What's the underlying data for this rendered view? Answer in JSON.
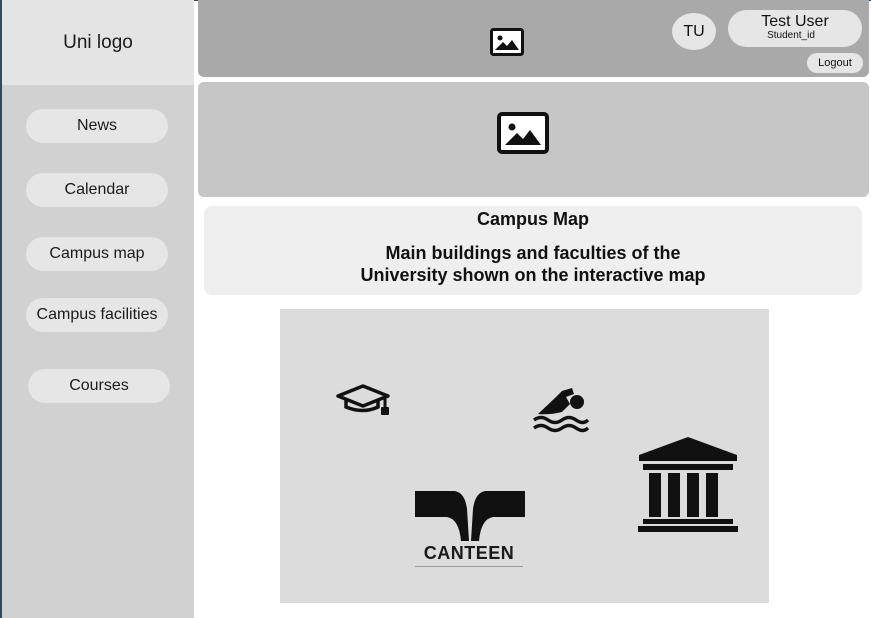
{
  "sidebar": {
    "logo": "Uni logo",
    "items": [
      {
        "label": "News"
      },
      {
        "label": "Calendar"
      },
      {
        "label": "Campus map"
      },
      {
        "label": "Campus facilities"
      },
      {
        "label": "Courses"
      }
    ]
  },
  "header": {
    "image_icon": "image-placeholder-icon",
    "avatar_initials": "TU",
    "user_name": "Test User",
    "user_id": "Student_id",
    "logout_label": "Logout"
  },
  "banner": {
    "image_icon": "image-placeholder-icon"
  },
  "info": {
    "title": "Campus Map",
    "description_line1": "Main buildings and faculties of the",
    "description_line2": "University shown on the interactive map"
  },
  "map": {
    "markers": [
      {
        "icon": "graduation-cap-icon"
      },
      {
        "icon": "swimmer-icon"
      },
      {
        "icon": "university-building-icon"
      },
      {
        "icon": "canteen-logo",
        "label": "CANTEEN"
      }
    ]
  },
  "colors": {
    "sidebar_bg": "#d1d1d1",
    "header_bg": "#a9a9a9",
    "banner_bg": "#c6c6c6",
    "map_bg": "#dcdcdc",
    "pill_bg": "#e6e6e6"
  }
}
